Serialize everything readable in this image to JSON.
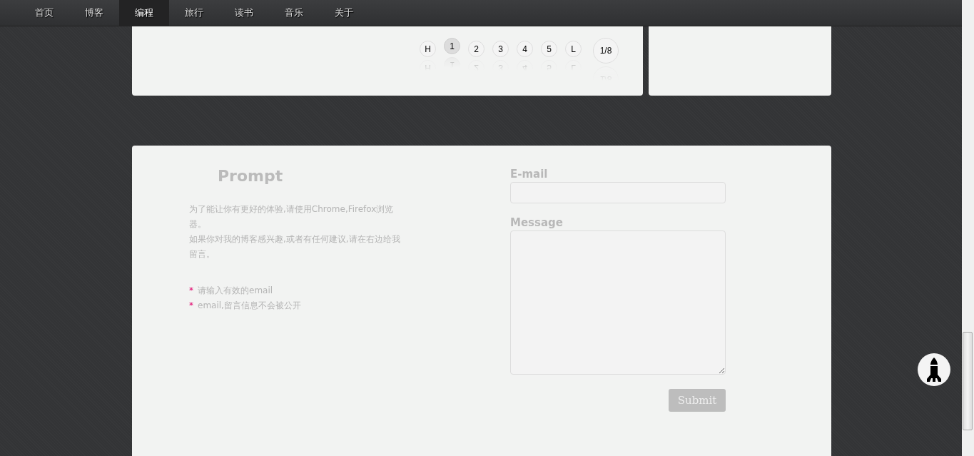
{
  "nav": [
    {
      "label": "首页",
      "selected": false
    },
    {
      "label": "博客",
      "selected": false
    },
    {
      "label": "编程",
      "selected": true
    },
    {
      "label": "旅行",
      "selected": false
    },
    {
      "label": "读书",
      "selected": false
    },
    {
      "label": "音乐",
      "selected": false
    },
    {
      "label": "关于",
      "selected": false
    }
  ],
  "pagination": {
    "pages": [
      {
        "label": "H",
        "selected": false
      },
      {
        "label": "1",
        "selected": true
      },
      {
        "label": "2",
        "selected": false
      },
      {
        "label": "3",
        "selected": false
      },
      {
        "label": "4",
        "selected": false
      },
      {
        "label": "5",
        "selected": false
      },
      {
        "label": "L",
        "selected": false
      }
    ],
    "page_count": "1/8"
  },
  "prompt": {
    "title": "Prompt",
    "paragraphs": [
      "为了能让你有更好的体验,请使用Chrome,Firefox浏览器。",
      "如果你对我的博客感兴趣,或者有任何建议,请在右边给我留言。"
    ],
    "notes": [
      {
        "mark": "*",
        "text": "请输入有效的email"
      },
      {
        "mark": "*",
        "text": "email,留言信息不会被公开"
      }
    ]
  },
  "form": {
    "email_label": "E-mail",
    "message_label": "Message",
    "submit": "Submit"
  }
}
